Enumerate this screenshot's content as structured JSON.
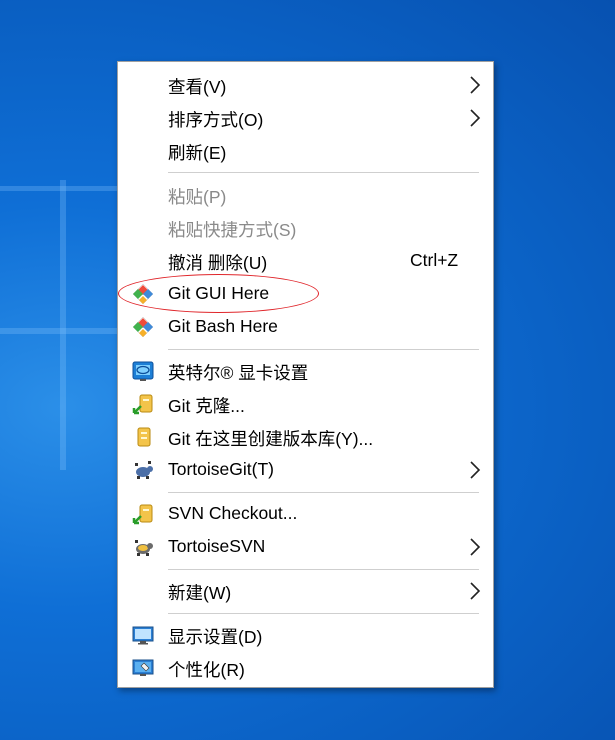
{
  "menu": {
    "view": "查看(V)",
    "sort": "排序方式(O)",
    "refresh": "刷新(E)",
    "paste": "粘贴(P)",
    "paste_shortcut": "粘贴快捷方式(S)",
    "undo_delete": "撤消 删除(U)",
    "undo_shortcut": "Ctrl+Z",
    "git_gui": "Git GUI Here",
    "git_bash": "Git Bash Here",
    "intel_graphics": "英特尔® 显卡设置",
    "git_clone": "Git 克隆...",
    "git_create_repo": "Git 在这里创建版本库(Y)...",
    "tortoisegit": "TortoiseGit(T)",
    "svn_checkout": "SVN Checkout...",
    "tortoisesvn": "TortoiseSVN",
    "new": "新建(W)",
    "display_settings": "显示设置(D)",
    "personalize": "个性化(R)"
  },
  "colors": {
    "annotation_circle": "#e0262b",
    "disabled_text": "#8a8a8a",
    "desktop": "#0a66c9"
  },
  "icons": {
    "git_gui": "git-diamond-icon",
    "git_bash": "git-diamond-icon",
    "intel_graphics": "intel-graphics-icon",
    "git_clone": "git-clone-icon",
    "git_create_repo": "git-repo-icon",
    "tortoisegit": "tortoisegit-icon",
    "svn_checkout": "svn-checkout-icon",
    "tortoisesvn": "tortoisesvn-icon",
    "display_settings": "display-icon",
    "personalize": "personalize-icon"
  }
}
